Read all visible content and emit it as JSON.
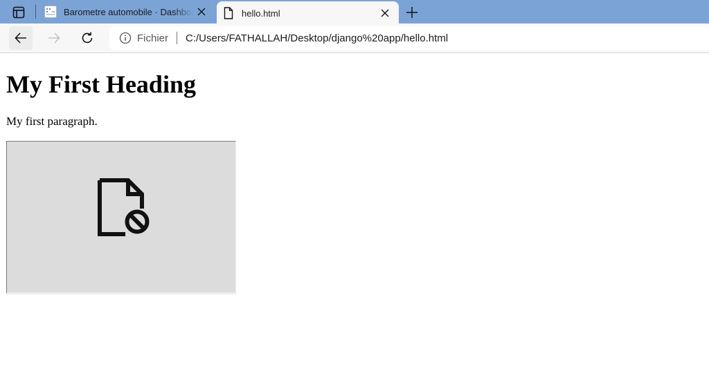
{
  "browser": {
    "tabs": [
      {
        "title": "Barometre automobile · Dashboard",
        "favicon": "dashboard-favicon",
        "active": false
      },
      {
        "title": "hello.html",
        "favicon": "file-icon",
        "active": true
      }
    ],
    "address_bar": {
      "security_label": "Fichier",
      "url": "C:/Users/FATHALLAH/Desktop/django%20app/hello.html"
    },
    "colors": {
      "tabstrip": "#7ba3d6",
      "toolbar": "#f7f7f7"
    }
  },
  "page": {
    "heading": "My First Heading",
    "paragraph": "My first paragraph.",
    "image": {
      "state": "broken",
      "icon": "broken-file-icon"
    }
  }
}
